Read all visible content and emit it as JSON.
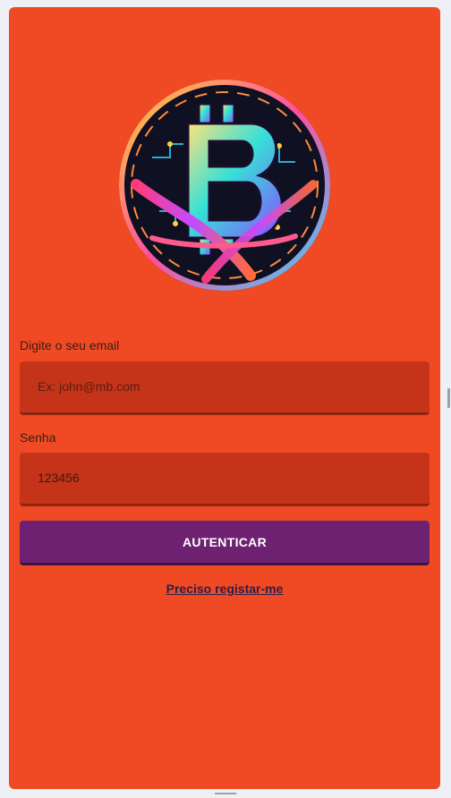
{
  "logo": {
    "icon": "bitcoin-logo-icon"
  },
  "form": {
    "email_label": "Digite o seu email",
    "email_placeholder": "Ex: john@mb.com",
    "email_value": "",
    "password_label": "Senha",
    "password_placeholder": "",
    "password_value": "123456",
    "submit_label": "AUTENTICAR",
    "register_link": "Preciso registar-me"
  },
  "colors": {
    "background": "#f04a24",
    "field": "#c53318",
    "button": "#6e2171",
    "link": "#2a1e4a"
  }
}
